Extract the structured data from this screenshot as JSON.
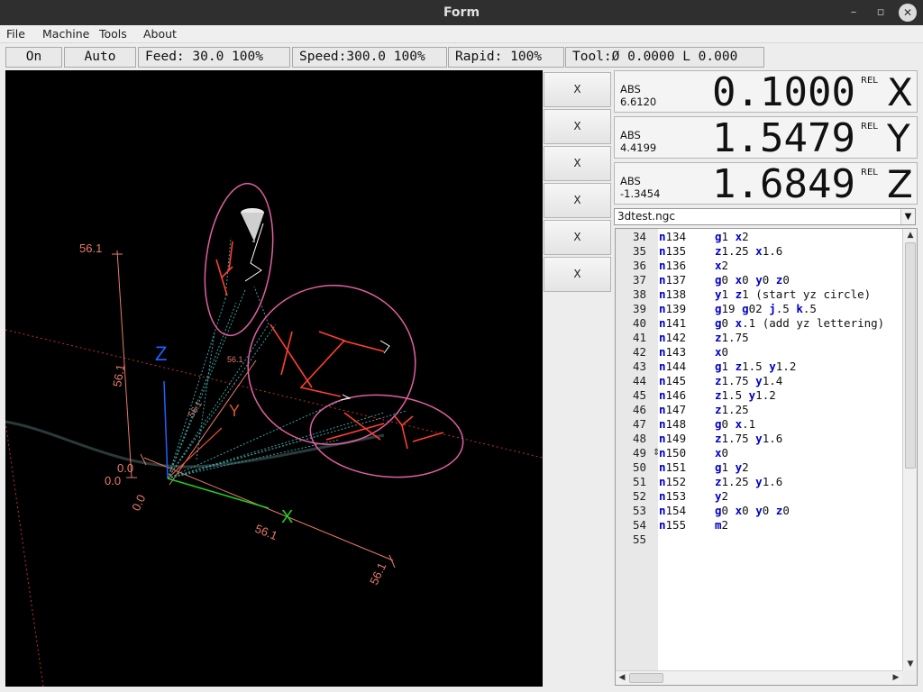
{
  "window": {
    "title": "Form",
    "minimize_glyph": "–",
    "maximize_glyph": "▫",
    "close_glyph": "✕"
  },
  "menu": [
    "File",
    "Machine",
    "Tools",
    "About"
  ],
  "toolbar": {
    "on": "On",
    "mode": "Auto",
    "feed": "Feed: 30.0  100%",
    "speed": "Speed:300.0 100%",
    "rapid": "Rapid: 100%",
    "tool": "Tool:Ø 0.0000 L 0.000"
  },
  "jog_buttons": [
    "X",
    "X",
    "X",
    "X",
    "X",
    "X"
  ],
  "dro": [
    {
      "abs_label": "ABS",
      "abs_value": "6.6120",
      "rel_label": "REL",
      "value": "0.1000",
      "axis": "X"
    },
    {
      "abs_label": "ABS",
      "abs_value": "4.4199",
      "rel_label": "REL",
      "value": "1.5479",
      "axis": "Y"
    },
    {
      "abs_label": "ABS",
      "abs_value": "-1.3454",
      "rel_label": "REL",
      "value": "1.6849",
      "axis": "Z"
    }
  ],
  "file": {
    "name": "3dtest.ngc",
    "arrow": "▼"
  },
  "code_lines": [
    {
      "ln": "34",
      "n": "134",
      "cmd": "g1 x2"
    },
    {
      "ln": "35",
      "n": "135",
      "cmd": "z1.25 x1.6"
    },
    {
      "ln": "36",
      "n": "136",
      "cmd": "x2"
    },
    {
      "ln": "37",
      "n": "137",
      "cmd": "g0 x0 y0 z0"
    },
    {
      "ln": "38",
      "n": "138",
      "cmd": "y1 z1 (start yz circle)"
    },
    {
      "ln": "39",
      "n": "139",
      "cmd": "g19 g02 j.5 k.5"
    },
    {
      "ln": "40",
      "n": "141",
      "cmd": "g0 x.1 (add yz lettering)"
    },
    {
      "ln": "41",
      "n": "142",
      "cmd": "z1.75"
    },
    {
      "ln": "42",
      "n": "143",
      "cmd": "x0"
    },
    {
      "ln": "43",
      "n": "144",
      "cmd": "g1 z1.5 y1.2"
    },
    {
      "ln": "44",
      "n": "145",
      "cmd": "z1.75 y1.4"
    },
    {
      "ln": "45",
      "n": "146",
      "cmd": "z1.5 y1.2"
    },
    {
      "ln": "46",
      "n": "147",
      "cmd": "z1.25"
    },
    {
      "ln": "47",
      "n": "148",
      "cmd": "g0 x.1"
    },
    {
      "ln": "48",
      "n": "149",
      "cmd": "z1.75 y1.6"
    },
    {
      "ln": "49",
      "n": "150",
      "cmd": "x0"
    },
    {
      "ln": "50",
      "n": "151",
      "cmd": "g1 y2"
    },
    {
      "ln": "51",
      "n": "152",
      "cmd": "z1.25 y1.6"
    },
    {
      "ln": "52",
      "n": "153",
      "cmd": "y2"
    },
    {
      "ln": "53",
      "n": "154",
      "cmd": "g0 x0 y0 z0"
    },
    {
      "ln": "54",
      "n": "155",
      "cmd": "m2"
    },
    {
      "ln": "55",
      "n": "",
      "cmd": ""
    }
  ],
  "viewport": {
    "dim_labels": [
      "56.1",
      "56.1",
      "56.1",
      "56.1",
      "56.1",
      "56.1",
      "0.0",
      "0.0",
      "0.0"
    ],
    "axis_labels": {
      "x": "X",
      "y": "Y",
      "z": "Z"
    },
    "colors": {
      "background": "#000000",
      "dimension": "#e87a6a",
      "x_axis": "#20d020",
      "y_axis": "#e05030",
      "z_axis": "#2060ff",
      "circle": "#e060a0",
      "feed_path": "#ff4030",
      "rapid_path": "#3fa0a0",
      "tool": "#ffffff"
    }
  },
  "scroll": {
    "up": "▲",
    "down": "▼",
    "left": "◀",
    "right": "▶"
  }
}
